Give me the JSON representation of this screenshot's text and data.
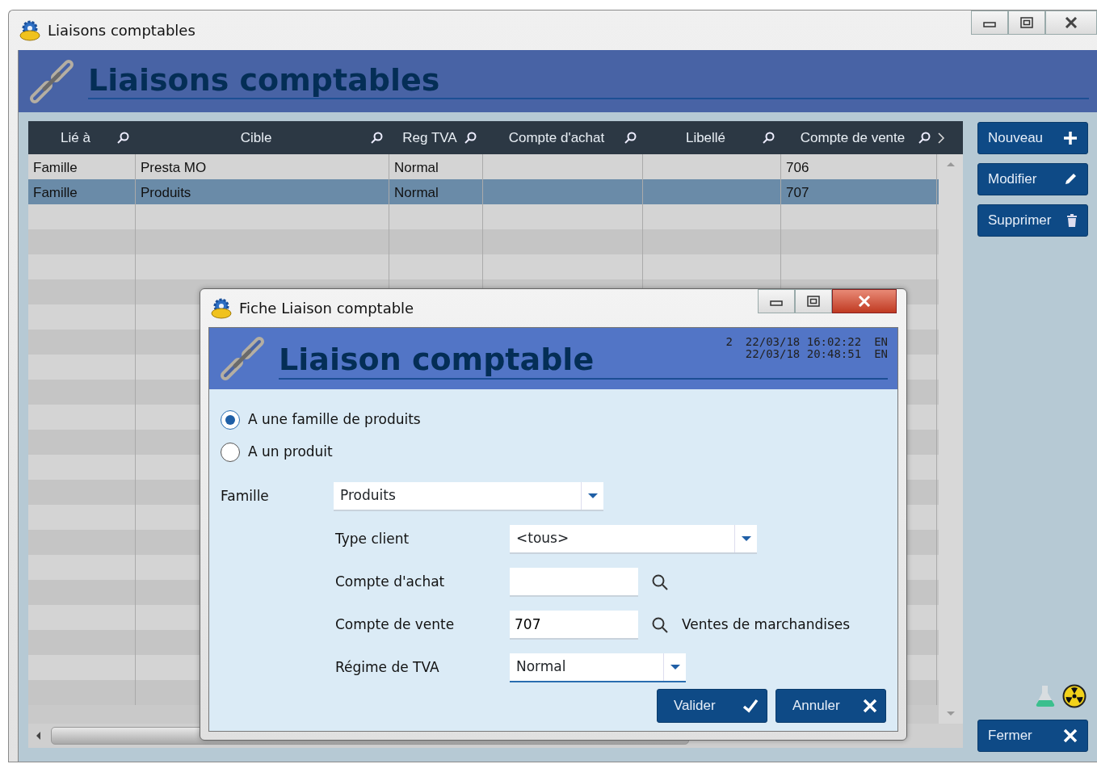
{
  "window": {
    "title": "Liaisons comptables"
  },
  "header": {
    "title": "Liaisons comptables"
  },
  "table": {
    "columns": [
      {
        "label": "Lié à"
      },
      {
        "label": "Cible"
      },
      {
        "label": "Reg TVA"
      },
      {
        "label": "Compte d'achat"
      },
      {
        "label": "Libellé"
      },
      {
        "label": "Compte de vente"
      }
    ],
    "rows": [
      {
        "lie_a": "Famille",
        "cible": "Presta MO",
        "reg_tva": "Normal",
        "compte_de_vente": "706",
        "selected": false
      },
      {
        "lie_a": "Famille",
        "cible": "Produits",
        "reg_tva": "Normal",
        "compte_de_vente": "707",
        "selected": true
      }
    ]
  },
  "actions": [
    {
      "label": "Nouveau",
      "kind": "add"
    },
    {
      "label": "Modifier",
      "kind": "edit"
    },
    {
      "label": "Supprimer",
      "kind": "delete"
    }
  ],
  "close_button": {
    "label": "Fermer"
  },
  "dialog": {
    "title": "Fiche Liaison comptable",
    "header": {
      "title": "Liaison comptable",
      "info_lines": [
        {
          "count": "2",
          "datetime": "22/03/18 16:02:22",
          "lang": "EN"
        },
        {
          "datetime": "22/03/18 20:48:51",
          "lang": "EN"
        }
      ]
    },
    "options": [
      {
        "label": "A une famille de produits",
        "selected": true
      },
      {
        "label": "A un produit",
        "selected": false
      }
    ],
    "fields": [
      {
        "label": "Famille",
        "kind": "combo",
        "value": "Produits",
        "focused": false,
        "children": [
          {
            "label": "Type client",
            "kind": "combo",
            "value": "<tous>",
            "focused": false
          },
          {
            "label": "Compte d'achat",
            "kind": "lookup",
            "focused": false
          },
          {
            "label": "Compte de vente",
            "kind": "lookup",
            "value": "707",
            "description": "Ventes de marchandises",
            "focused": false
          },
          {
            "label": "Régime de TVA",
            "kind": "combo",
            "value": "Normal",
            "focused": true
          }
        ]
      }
    ],
    "buttons": [
      {
        "label": "Valider",
        "kind": "ok"
      },
      {
        "label": "Annuler",
        "kind": "cancel"
      }
    ]
  }
}
